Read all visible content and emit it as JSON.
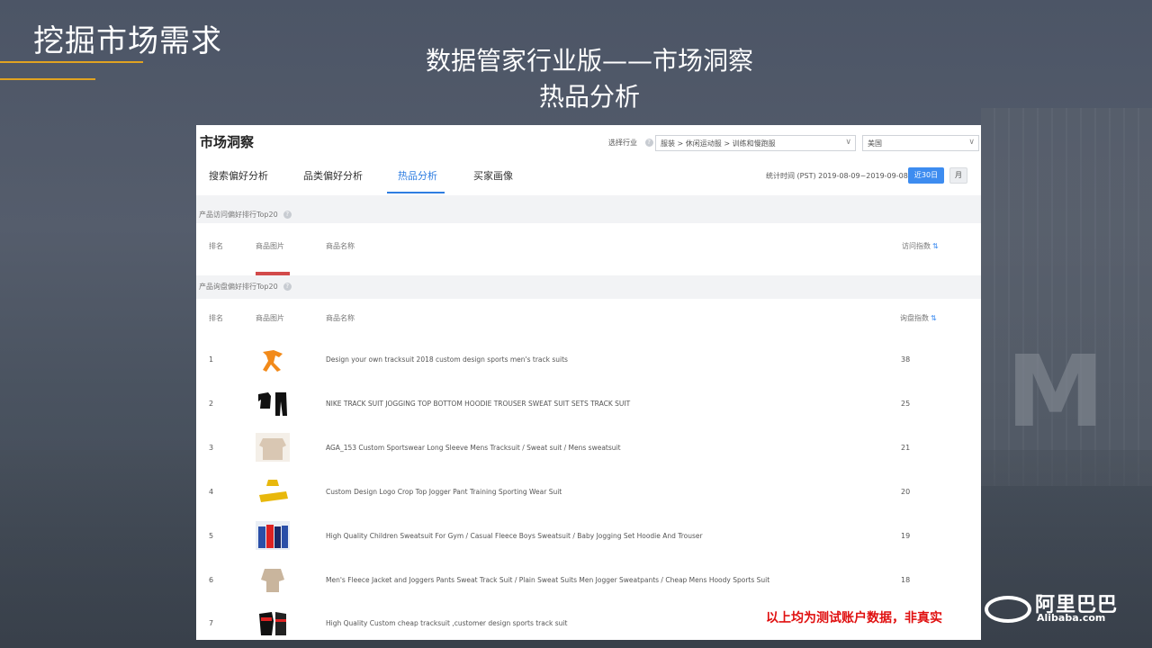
{
  "slide": {
    "title": "挖掘市场需求",
    "center_title_line1": "数据管家行业版——市场洞察",
    "center_title_line2": "热品分析",
    "disclaimer": "以上均为测试账户数据，非真实",
    "logo_cn": "阿里巴巴",
    "logo_en": "Alibaba.com",
    "accent_color": "#e0a321"
  },
  "market": {
    "title": "市场洞察",
    "industry_label": "选择行业",
    "industry_value": "服装 > 休闲运动服 > 训练和慢跑服",
    "country_value": "美国",
    "tabs": [
      {
        "label": "搜索偏好分析"
      },
      {
        "label": "品类偏好分析"
      },
      {
        "label": "热品分析"
      },
      {
        "label": "买家画像"
      }
    ],
    "active_tab": "热品分析",
    "stat_time": "统计时间 (PST) 2019-08-09~2019-09-08",
    "btn_30": "近30日",
    "btn_month": "月"
  },
  "section1": {
    "title": "产品访问偏好排行Top20",
    "col_rank": "排名",
    "col_image": "商品图片",
    "col_name": "商品名称",
    "col_value": "访问指数"
  },
  "section2": {
    "title": "产品询盘偏好排行Top20",
    "col_rank": "排名",
    "col_image": "商品图片",
    "col_name": "商品名称",
    "col_value": "询盘指数",
    "rows": [
      {
        "rank": "1",
        "name": "Design your own tracksuit 2018 custom design sports men's track suits",
        "value": "38"
      },
      {
        "rank": "2",
        "name": "NIKE TRACK SUIT JOGGING TOP BOTTOM HOODIE TROUSER SWEAT SUIT SETS TRACK SUIT",
        "value": "25"
      },
      {
        "rank": "3",
        "name": "AGA_153 Custom Sportswear Long Sleeve Mens Tracksuit / Sweat suit / Mens sweatsuit",
        "value": "21"
      },
      {
        "rank": "4",
        "name": "Custom Design Logo Crop Top Jogger Pant Training Sporting Wear Suit",
        "value": "20"
      },
      {
        "rank": "5",
        "name": "High Quality Children Sweatsuit For Gym / Casual Fleece Boys Sweatsuit / Baby Jogging Set Hoodie And Trouser",
        "value": "19"
      },
      {
        "rank": "6",
        "name": "Men's Fleece Jacket and Joggers Pants Sweat Track Suit / Plain Sweat Suits Men Jogger Sweatpants / Cheap Mens Hoody Sports Suit",
        "value": "18"
      },
      {
        "rank": "7",
        "name": "High Quality Custom cheap tracksuit ,customer design sports track suit",
        "value": ""
      }
    ]
  }
}
